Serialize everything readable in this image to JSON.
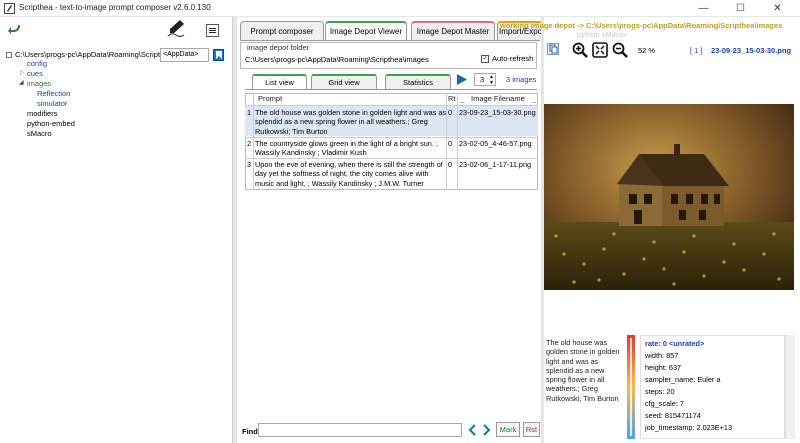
{
  "window": {
    "title": "Scripthea - text-to-image prompt composer v2.6.0.130",
    "minimize": "—",
    "maximize": "☐",
    "close": "✕"
  },
  "left": {
    "tree_root": "C:\\Users\\progs-pc\\AppData\\Roaming\\Scripthea",
    "appdata_select": "<AppData>",
    "items": [
      {
        "label": "config",
        "color": "#1e40af"
      },
      {
        "label": "cues",
        "color": "#1e40af"
      },
      {
        "label": "images",
        "color": "#2e7d32"
      },
      {
        "label": "Reflection",
        "color": "#1e40af"
      },
      {
        "label": "simulator",
        "color": "#1e40af"
      },
      {
        "label": "modifiers",
        "color": "#000000"
      },
      {
        "label": "python-embed",
        "color": "#000000"
      },
      {
        "label": "sMacro",
        "color": "#000000"
      }
    ]
  },
  "tabs": [
    "Prompt  composer",
    "Image Depot Viewer",
    "Image Depot Master",
    "Import/Export"
  ],
  "depot": {
    "legend": "image depot folder",
    "path": "C:\\Users\\progs-pc\\AppData\\Roaming\\Scripthea\\images",
    "auto_refresh": "Auto-refresh",
    "auto_refresh_checked": true
  },
  "subtabs": [
    "List view",
    "Grid view",
    "Statistics"
  ],
  "count_value": "3",
  "images_count": "3 images",
  "table": {
    "headers": [
      "Prompt",
      "Rt",
      "Image  Filename"
    ],
    "sort_marks": [
      "_",
      "_"
    ],
    "rows": [
      {
        "n": "1",
        "prompt": "The old house was golden stone in golden light and was as splendid as a new spring flower in all weathers.; Greg Rutkowski; Tim Burton",
        "rt": "0",
        "file": "23-09-23_15-03-30.png"
      },
      {
        "n": "2",
        "prompt": "The countryside glows green in the light of a bright sun. ; Wassily Kandinsky ; Vladimir Kush",
        "rt": "0",
        "file": "23-02-05_4-46-57.png"
      },
      {
        "n": "3",
        "prompt": "Upon the eve of evening, when there is still the strength of day yet the softness of night, the city comes alive with music and light. ; Wassily Kandinsky ; J.M.W. Turner",
        "rt": "0",
        "file": "23-02-06_1-17-11.png"
      }
    ]
  },
  "find": {
    "label": "Find",
    "mark": "Mark",
    "reset": "Rst"
  },
  "viewer": {
    "header": "working image depot -> C:\\Users\\progs-pc\\AppData\\Roaming\\Scripthea\\images",
    "python_smacro": "python sMacro",
    "zoom": "52 %",
    "index": "[ 1 ]",
    "filename": "23-09-23_15-03-30.png",
    "prompt": "The old house was golden stone in golden light and was as splendid as a new spring flower in all weathers.; Greg Rutkowski; Tim Burton",
    "props": [
      "rate: 0 <unrated>",
      "width: 857",
      "height: 637",
      "sampler_name: Euler a",
      "steps: 20",
      "cfg_scale: 7",
      "seed: 815471174",
      "job_timestamp: 2.023E+13"
    ]
  },
  "colors": {
    "accent_blue": "#1e40af",
    "tab_green": "#43a047",
    "tab_orange": "#ff9800"
  }
}
